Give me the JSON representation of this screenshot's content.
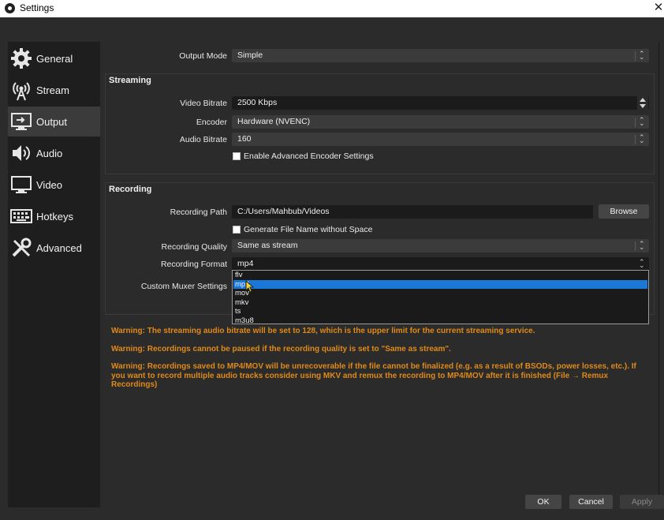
{
  "window": {
    "title": "Settings",
    "close_glyph": "✕"
  },
  "sidebar": {
    "items": [
      {
        "label": "General",
        "icon": "gear-icon"
      },
      {
        "label": "Stream",
        "icon": "antenna-icon"
      },
      {
        "label": "Output",
        "icon": "output-monitor-icon"
      },
      {
        "label": "Audio",
        "icon": "speaker-icon"
      },
      {
        "label": "Video",
        "icon": "monitor-icon"
      },
      {
        "label": "Hotkeys",
        "icon": "keyboard-icon"
      },
      {
        "label": "Advanced",
        "icon": "tools-icon"
      }
    ],
    "active": "Output"
  },
  "output_mode": {
    "label": "Output Mode",
    "value": "Simple"
  },
  "streaming": {
    "title": "Streaming",
    "video_bitrate": {
      "label": "Video Bitrate",
      "value": "2500 Kbps"
    },
    "encoder": {
      "label": "Encoder",
      "value": "Hardware (NVENC)"
    },
    "audio_bitrate": {
      "label": "Audio Bitrate",
      "value": "160"
    },
    "advanced_encoder": {
      "label": "Enable Advanced Encoder Settings",
      "checked": false
    }
  },
  "recording": {
    "title": "Recording",
    "path": {
      "label": "Recording Path",
      "value": "C:/Users/Mahbub/Videos",
      "browse_label": "Browse"
    },
    "no_space": {
      "label": "Generate File Name without Space",
      "checked": false
    },
    "quality": {
      "label": "Recording Quality",
      "value": "Same as stream"
    },
    "format": {
      "label": "Recording Format",
      "value": "mp4"
    },
    "muxer": {
      "label": "Custom Muxer Settings"
    },
    "format_options": [
      "flv",
      "mp4",
      "mov",
      "mkv",
      "ts",
      "m3u8"
    ],
    "highlighted_option": "mp4"
  },
  "warnings": [
    "Warning: The streaming audio bitrate will be set to 128, which is the upper limit for the current streaming service.",
    "Warning: Recordings cannot be paused if the recording quality is set to \"Same as stream\".",
    "Warning: Recordings saved to MP4/MOV will be unrecoverable if the file cannot be finalized (e.g. as a result of BSODs, power losses, etc.). If you want to record multiple audio tracks consider using MKV and remux the recording to MP4/MOV after it is finished (File → Remux Recordings)"
  ],
  "footer": {
    "ok": "OK",
    "cancel": "Cancel",
    "apply": "Apply"
  },
  "colors": {
    "accent": "#1a78d9",
    "warning": "#e08a18",
    "panel": "#2b2b2b",
    "sidebar": "#1e1e1e"
  }
}
